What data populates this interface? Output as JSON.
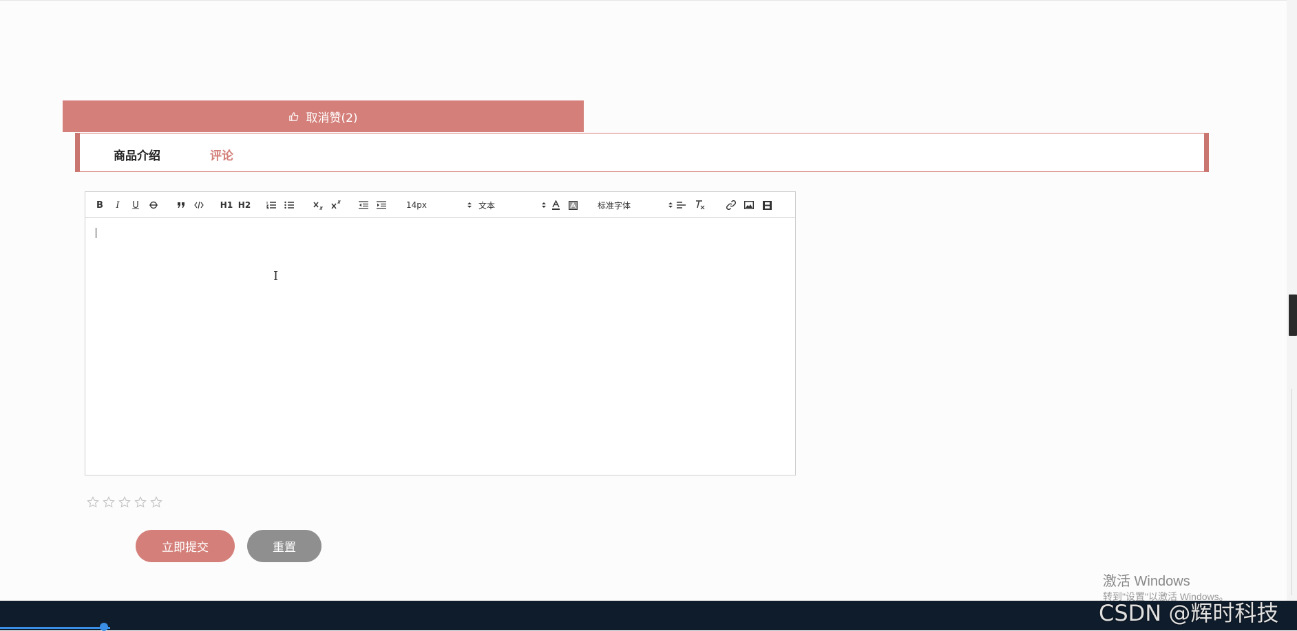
{
  "like": {
    "label": "取消赞(2)",
    "icon": "thumbs-up-icon"
  },
  "tabs": {
    "intro": "商品介绍",
    "comment": "评论"
  },
  "editor": {
    "toolbar": {
      "bold": "B",
      "italic": "I",
      "underline": "U",
      "h1": "H1",
      "h2": "H2",
      "font_size": "14px",
      "heading_picker": "文本",
      "font_family": "标准字体"
    }
  },
  "rating": {
    "stars": 5,
    "filled": 0
  },
  "buttons": {
    "submit": "立即提交",
    "reset": "重置"
  },
  "watermark": {
    "title": "激活 Windows",
    "subtitle": "转到\"设置\"以激活 Windows。",
    "csdn": "CSDN @辉时科技"
  },
  "colors": {
    "accent": "#d47f79",
    "reset": "#8f8f8f",
    "taskbar": "#0f1c2c"
  }
}
